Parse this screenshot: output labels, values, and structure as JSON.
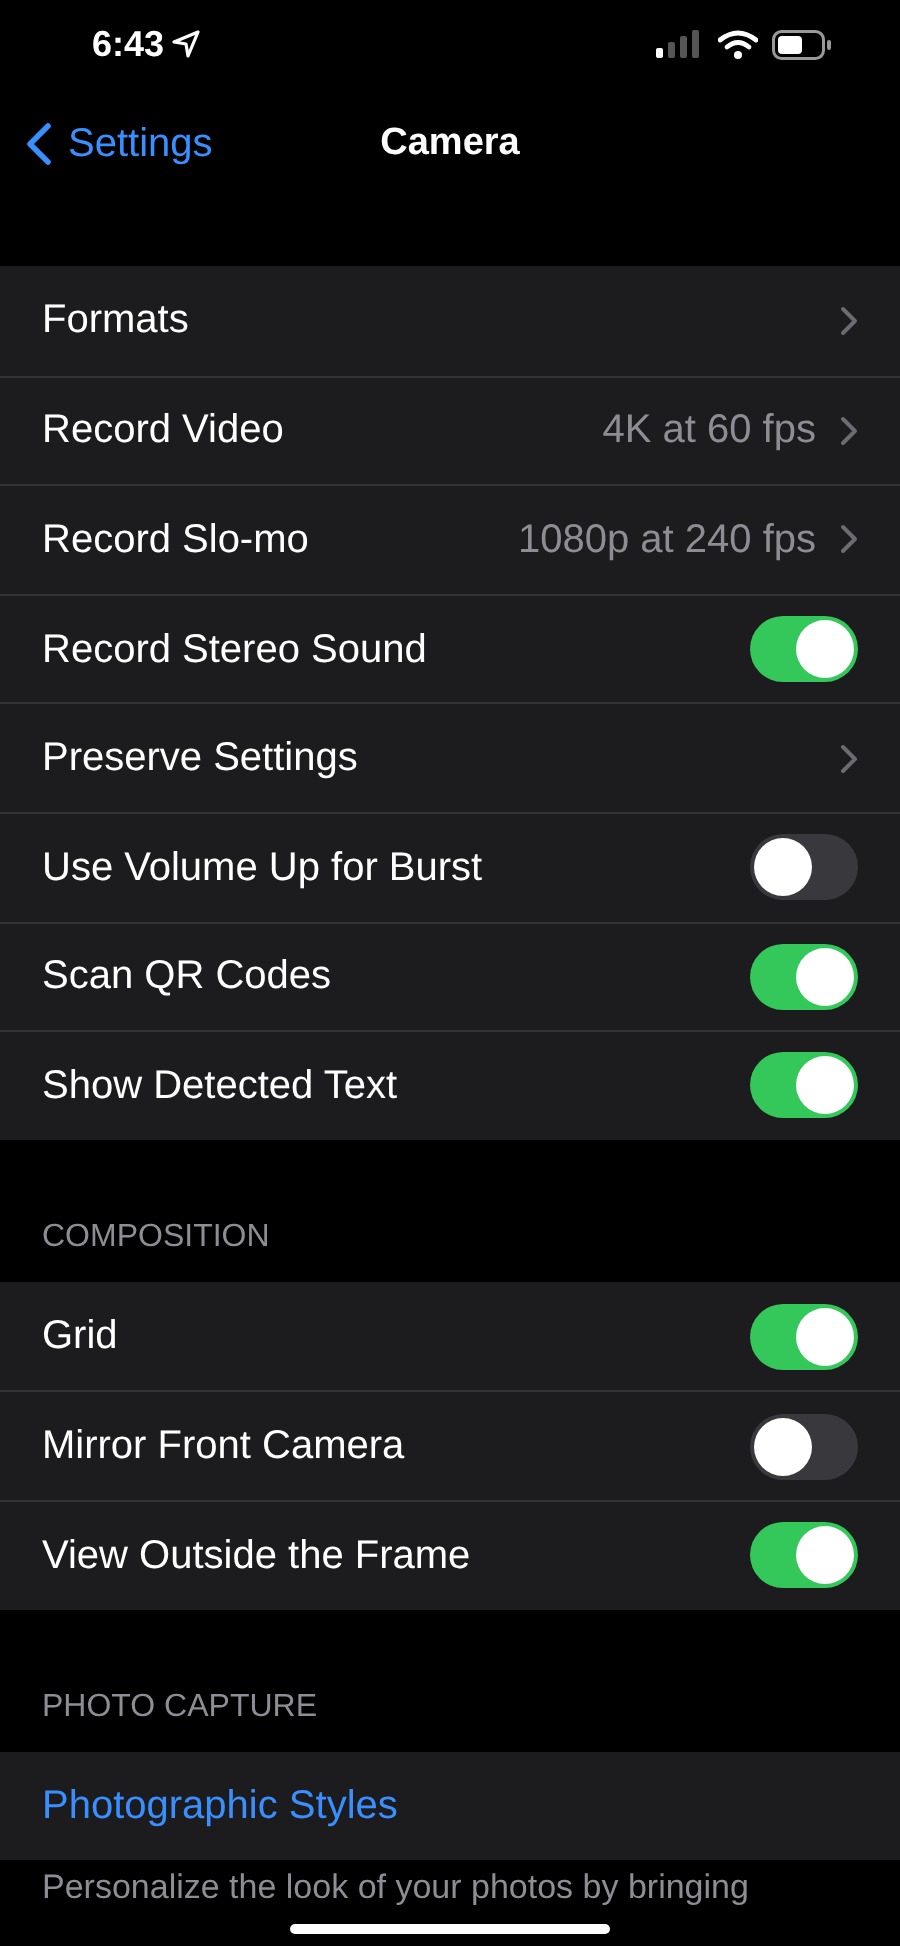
{
  "status_bar": {
    "time": "6:43"
  },
  "nav": {
    "back": "Settings",
    "title": "Camera"
  },
  "sections": [
    {
      "items": [
        {
          "kind": "link",
          "label": "Formats"
        },
        {
          "kind": "link",
          "label": "Record Video",
          "value": "4K at 60 fps"
        },
        {
          "kind": "link",
          "label": "Record Slo-mo",
          "value": "1080p at 240 fps"
        },
        {
          "kind": "toggle",
          "label": "Record Stereo Sound",
          "on": true
        },
        {
          "kind": "link",
          "label": "Preserve Settings"
        },
        {
          "kind": "toggle",
          "label": "Use Volume Up for Burst",
          "on": false
        },
        {
          "kind": "toggle",
          "label": "Scan QR Codes",
          "on": true
        },
        {
          "kind": "toggle",
          "label": "Show Detected Text",
          "on": true
        }
      ]
    },
    {
      "header": "COMPOSITION",
      "items": [
        {
          "kind": "toggle",
          "label": "Grid",
          "on": true
        },
        {
          "kind": "toggle",
          "label": "Mirror Front Camera",
          "on": false
        },
        {
          "kind": "toggle",
          "label": "View Outside the Frame",
          "on": true
        }
      ]
    },
    {
      "header": "PHOTO CAPTURE",
      "items": [
        {
          "kind": "action",
          "label": "Photographic Styles"
        }
      ],
      "footer": "Personalize the look of your photos by bringing"
    }
  ]
}
